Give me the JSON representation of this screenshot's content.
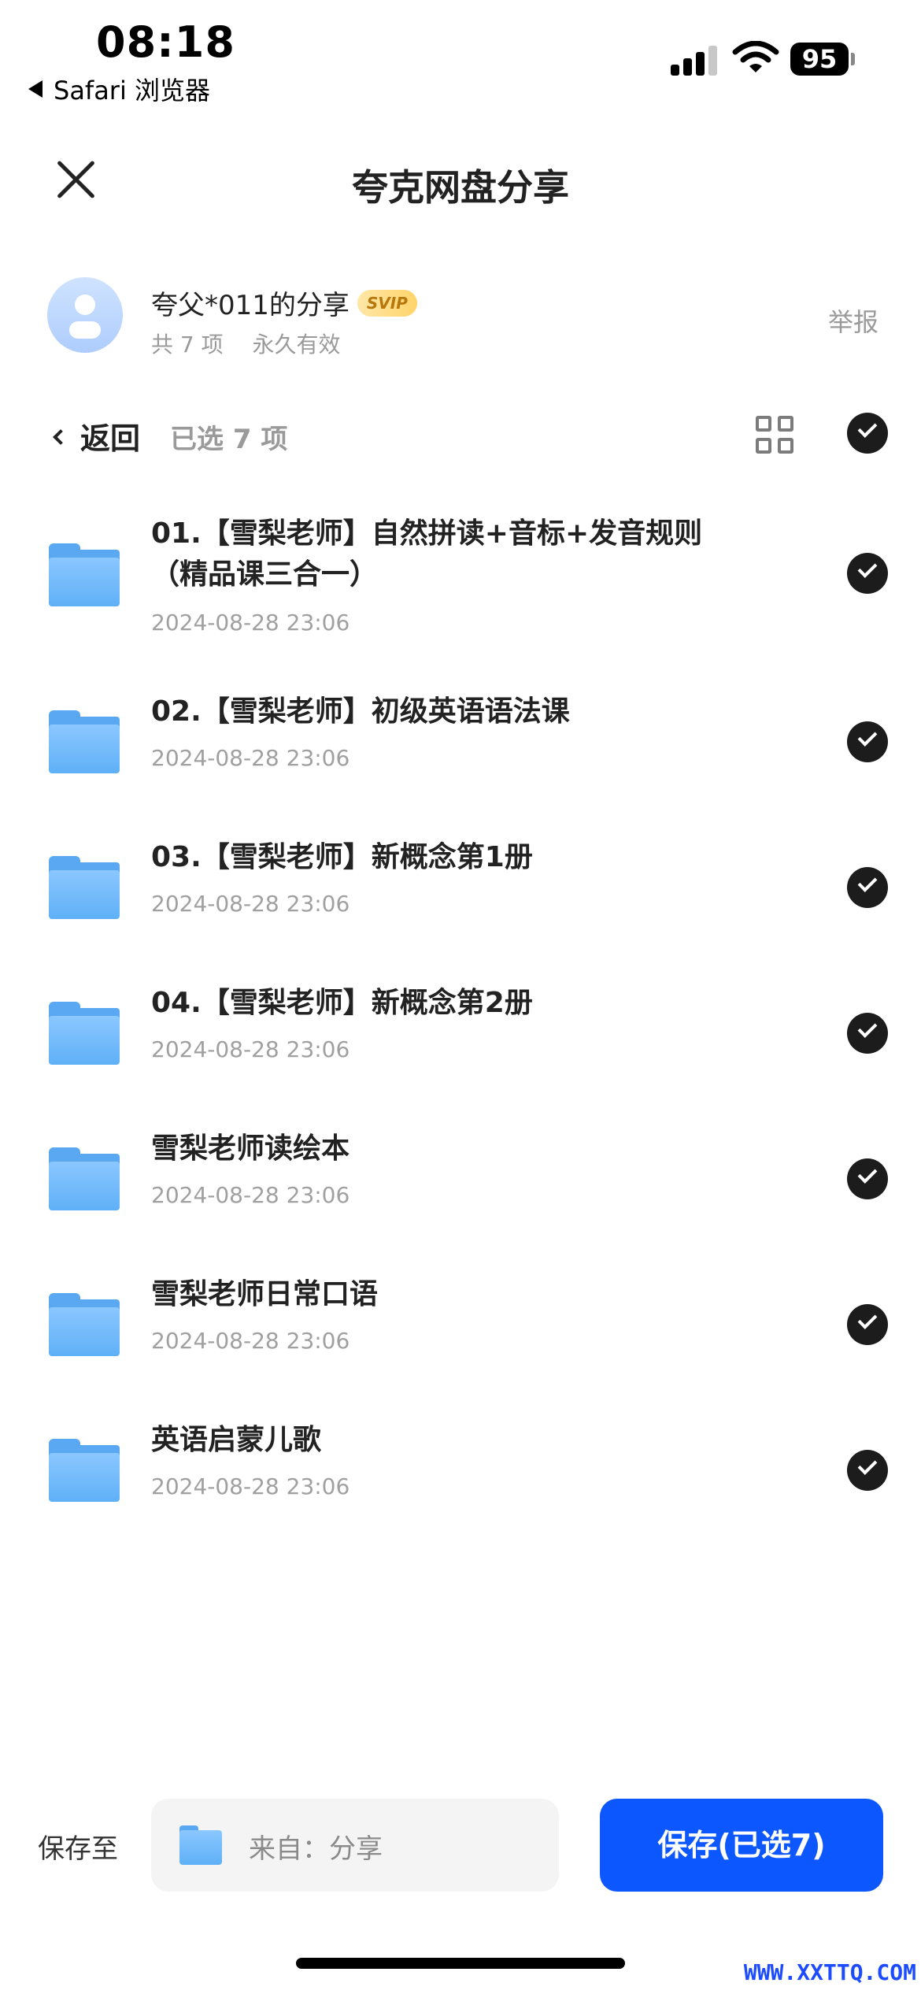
{
  "status_bar": {
    "time": "08:18",
    "back_app": "Safari 浏览器",
    "battery": "95"
  },
  "header": {
    "title": "夸克网盘分享"
  },
  "sharer": {
    "name": "夸父*011的分享",
    "badge": "SVIP",
    "item_count": "共 7 项",
    "validity": "永久有效",
    "report": "举报"
  },
  "toolbar": {
    "back_label": "返回",
    "selected_label": "已选 7 项"
  },
  "files": [
    {
      "name": "01.【雪梨老师】自然拼读+音标+发音规则（精品课三合一）",
      "date": "2024-08-28 23:06"
    },
    {
      "name": "02.【雪梨老师】初级英语语法课",
      "date": "2024-08-28 23:06"
    },
    {
      "name": "03.【雪梨老师】新概念第1册",
      "date": "2024-08-28 23:06"
    },
    {
      "name": "04.【雪梨老师】新概念第2册",
      "date": "2024-08-28 23:06"
    },
    {
      "name": "雪梨老师读绘本",
      "date": "2024-08-28 23:06"
    },
    {
      "name": "雪梨老师日常口语",
      "date": "2024-08-28 23:06"
    },
    {
      "name": "英语启蒙儿歌",
      "date": "2024-08-28 23:06"
    }
  ],
  "bottom": {
    "save_to_label": "保存至",
    "destination": "来自：分享",
    "save_button": "保存(已选7)"
  },
  "watermark": "WWW.XXTTQ.COM",
  "colors": {
    "accent": "#0d57ff",
    "folder": "#5fb0f7"
  }
}
